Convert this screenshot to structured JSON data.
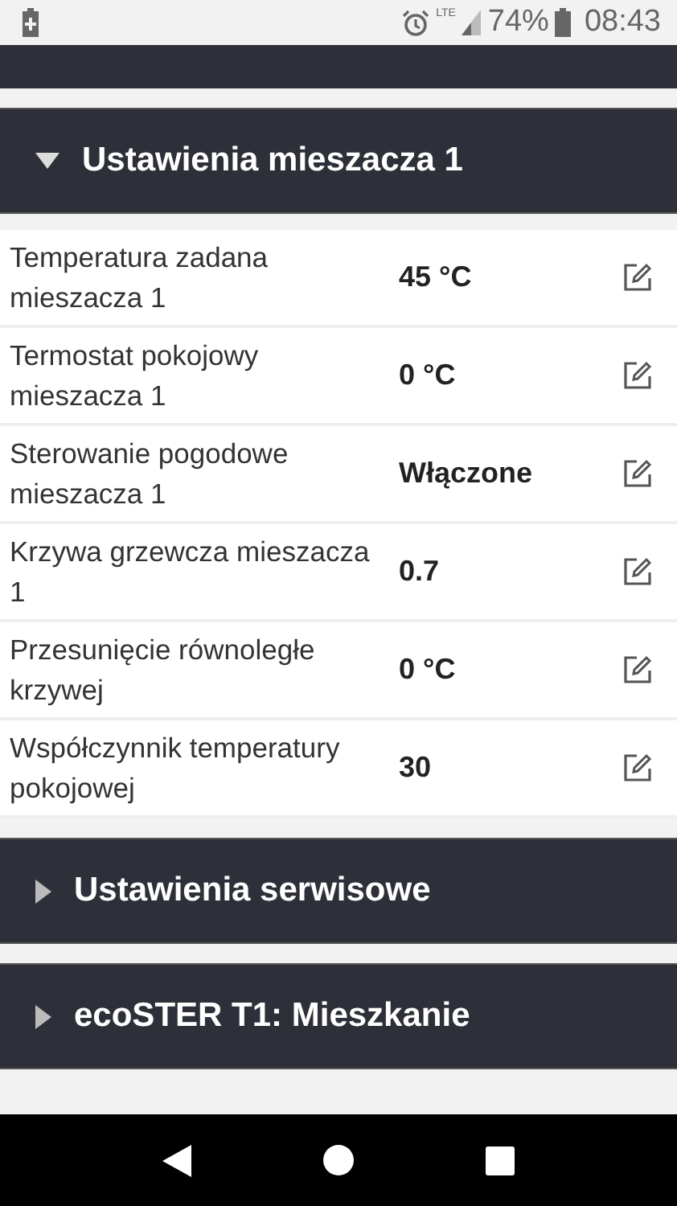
{
  "status_bar": {
    "network": "LTE",
    "battery": "74%",
    "time": "08:43"
  },
  "sections": [
    {
      "title": "Ustawienia mieszacza 1",
      "expanded": true,
      "rows": [
        {
          "label": "Temperatura zadana mieszacza 1",
          "value": "45 °C"
        },
        {
          "label": "Termostat pokojowy mieszacza 1",
          "value": "0 °C"
        },
        {
          "label": "Sterowanie pogodowe mieszacza 1",
          "value": "Włączone"
        },
        {
          "label": "Krzywa grzewcza mieszacza 1",
          "value": "0.7"
        },
        {
          "label": "Przesunięcie równoległe krzywej",
          "value": "0 °C"
        },
        {
          "label": "Współczynnik temperatury pokojowej",
          "value": "30"
        }
      ]
    },
    {
      "title": "Ustawienia serwisowe",
      "expanded": false
    },
    {
      "title": "ecoSTER T1: Mieszkanie",
      "expanded": false
    }
  ]
}
